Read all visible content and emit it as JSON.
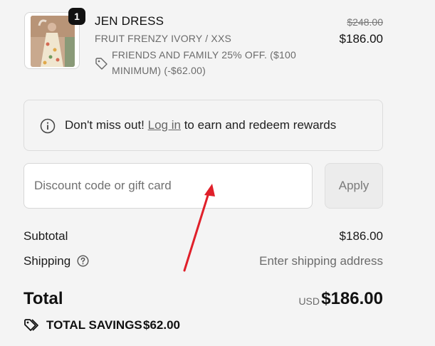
{
  "line_item": {
    "quantity": "1",
    "title": "JEN DRESS",
    "variant": "FRUIT FRENZY IVORY / XXS",
    "discount_text": "FRIENDS AND FAMILY 25% OFF. ($100 MINIMUM) (-$62.00)",
    "original_price": "$248.00",
    "price": "$186.00"
  },
  "rewards": {
    "prefix": "Don't miss out!",
    "link": "Log in",
    "suffix": "to earn and redeem rewards"
  },
  "discount": {
    "placeholder": "Discount code or gift card",
    "value": "",
    "apply_label": "Apply"
  },
  "summary": {
    "subtotal_label": "Subtotal",
    "subtotal_value": "$186.00",
    "shipping_label": "Shipping",
    "shipping_value": "Enter shipping address",
    "total_label": "Total",
    "currency": "USD",
    "total_value": "$186.00",
    "savings_label": "TOTAL SAVINGS",
    "savings_value": "$62.00"
  },
  "icons": {
    "discount_tag": "tag-icon",
    "info": "info-icon",
    "shipping_help": "question-circle-icon",
    "savings": "tags-icon"
  },
  "colors": {
    "background": "#f4f4f4",
    "badge": "#111111",
    "annotation_arrow": "#e0202a"
  }
}
